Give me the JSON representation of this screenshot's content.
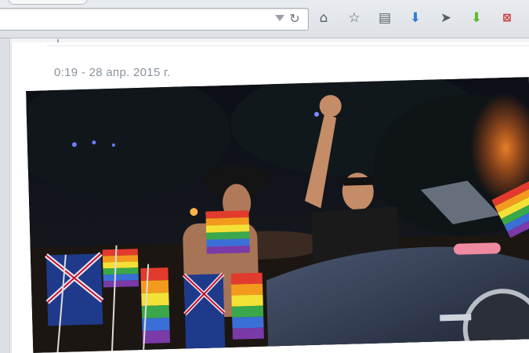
{
  "browser": {
    "toolbar_icons": [
      {
        "icon": "home-icon"
      },
      {
        "icon": "bookmark-star-icon"
      },
      {
        "icon": "reading-list-icon"
      },
      {
        "icon": "download-arrow-icon"
      },
      {
        "icon": "send-icon"
      },
      {
        "icon": "green-download-icon"
      },
      {
        "icon": "extension-icon"
      }
    ],
    "colors": {
      "download": "#2f7fd8",
      "green": "#5cb82a",
      "extension": "#c9302c"
    }
  },
  "post": {
    "timestamp": "0:19 - 28 апр. 2015 г.",
    "photo": {
      "icon": "pride-parade-photo"
    }
  }
}
